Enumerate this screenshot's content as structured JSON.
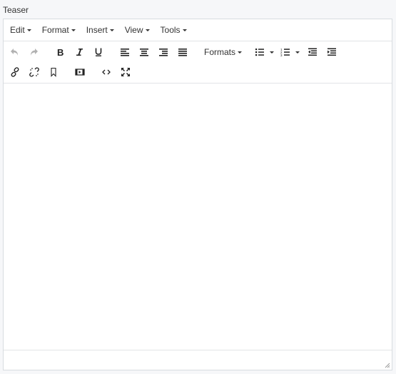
{
  "field": {
    "label": "Teaser"
  },
  "menubar": {
    "items": [
      {
        "label": "Edit"
      },
      {
        "label": "Format"
      },
      {
        "label": "Insert"
      },
      {
        "label": "View"
      },
      {
        "label": "Tools"
      }
    ]
  },
  "toolbar": {
    "formats_label": "Formats",
    "buttons": {
      "undo": "undo-icon",
      "redo": "redo-icon",
      "bold": "bold-icon",
      "italic": "italic-icon",
      "underline": "underline-icon",
      "align_left": "align-left-icon",
      "align_center": "align-center-icon",
      "align_right": "align-right-icon",
      "align_justify": "align-justify-icon",
      "bullet_list": "bullet-list-icon",
      "numbered_list": "numbered-list-icon",
      "outdent": "outdent-icon",
      "indent": "indent-icon",
      "link": "link-icon",
      "unlink": "unlink-icon",
      "anchor": "bookmark-icon",
      "media": "media-icon",
      "code": "code-icon",
      "fullscreen": "fullscreen-icon"
    }
  },
  "content": {
    "text": ""
  },
  "colors": {
    "icon": "#222222",
    "border": "#d8dce0",
    "background": "#f6f7f9"
  }
}
